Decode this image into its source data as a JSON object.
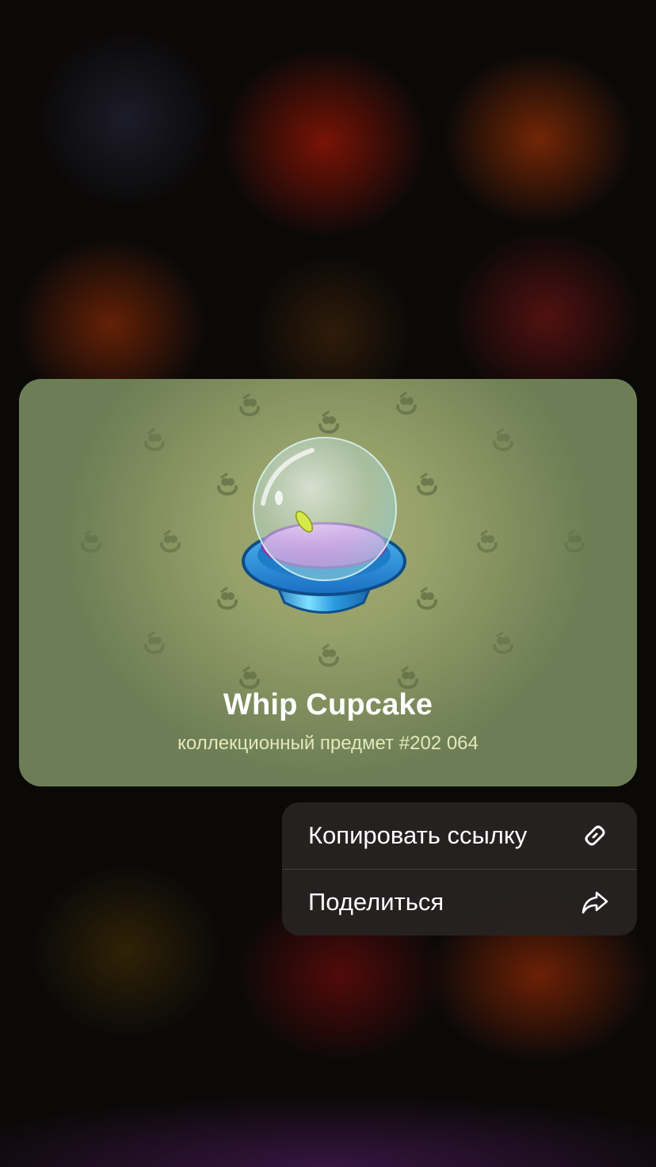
{
  "gift": {
    "name": "Whip Cupcake",
    "subtitle": "коллекционный предмет #202 064",
    "model_icon": "ufo-icon",
    "pattern_icon": "pattern-symbol-icon",
    "colors": {
      "backdrop_center": "#a8ad72",
      "backdrop_edge": "#6d7e56",
      "subtitle": "#e4e8b8"
    }
  },
  "context_menu": {
    "items": [
      {
        "label": "Копировать ссылку",
        "icon": "link-icon"
      },
      {
        "label": "Поделиться",
        "icon": "share-arrow-icon"
      }
    ]
  }
}
